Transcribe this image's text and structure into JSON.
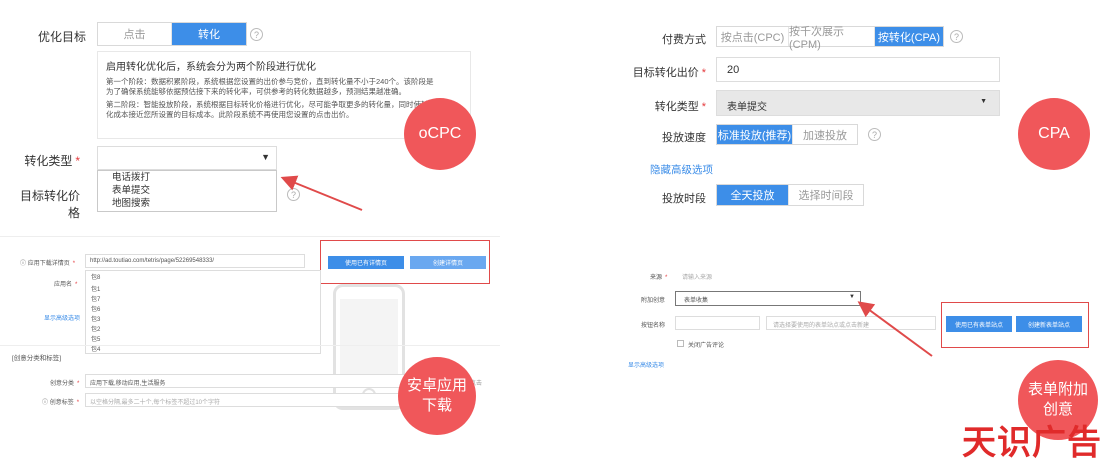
{
  "ocpc": {
    "goal_label": "优化目标",
    "goal_options": [
      "点击",
      "转化"
    ],
    "info_title": "启用转化优化后，系统会分为两个阶段进行优化",
    "info_p1": "第一个阶段：数据积累阶段，系统根据您设置的出价参与竞价，直到转化量不小于240个。该阶段是",
    "info_p1b": "为了确保系统能够依据预估接下来的转化率，可供参考的转化数据越多，预测结果越准确。",
    "info_p2": "第二阶段：智能投放阶段，系统根据目标转化价格进行优化，尽可能争取更多的转化量，同时使转",
    "info_p2b": "化成本接近您所设置的目标成本。此阶段系统不再使用您设置的点击出价。",
    "type_label": "转化类型",
    "type_options": [
      "电话拨打",
      "表单提交",
      "地图搜索"
    ],
    "price_label": "目标转化价格",
    "badge": "oCPC"
  },
  "android": {
    "url_label": "应用下载详情页",
    "url_value": "http://ad.toutiao.com/tetris/page/52269548333/",
    "btn_existing": "使用已有详情页",
    "btn_create": "创建详情页",
    "app_label": "应用名",
    "packages": [
      "包8",
      "包1",
      "包7",
      "包6",
      "包3",
      "包2",
      "包5",
      "包4"
    ],
    "advanced_link": "显示高级选项",
    "section_title": "[创意分类和标签]",
    "category_label": "创意分类",
    "category_value": "应用下载,移动应用,生活服务",
    "tag_label": "创意标签",
    "tag_placeholder": "以空格分隔,最多二十个,每个标签不超过10个字符",
    "side_text": "点击",
    "badge": "安卓应用\n下载"
  },
  "cpa": {
    "pay_label": "付费方式",
    "pay_options": [
      "按点击(CPC)",
      "按千次展示(CPM)",
      "按转化(CPA)"
    ],
    "bid_label": "目标转化出价",
    "bid_value": "20",
    "type_label": "转化类型",
    "type_value": "表单提交",
    "speed_label": "投放速度",
    "speed_options": [
      "标准投放(推荐)",
      "加速投放"
    ],
    "advanced_link": "隐藏高级选项",
    "period_label": "投放时段",
    "period_options": [
      "全天投放",
      "选择时间段"
    ],
    "badge": "CPA"
  },
  "form": {
    "source_label": "来源",
    "source_placeholder": "请输入来源",
    "attach_label": "附加创意",
    "attach_value": "表单收集",
    "button_name_label": "按钮名称",
    "station_placeholder": "请选择要使用的表单站点或点击新建",
    "btn_existing": "使用已有表单站点",
    "btn_create": "创建新表单站点",
    "checkbox_label": "关闭广告评论",
    "advanced_link": "显示高级选项",
    "badge": "表单附加\n创意"
  },
  "brand": "天识广告",
  "colors": {
    "accent": "#3d8ee8",
    "badge": "#f0575a",
    "highlight": "#e04a4a",
    "brand": "#e02a2a"
  }
}
